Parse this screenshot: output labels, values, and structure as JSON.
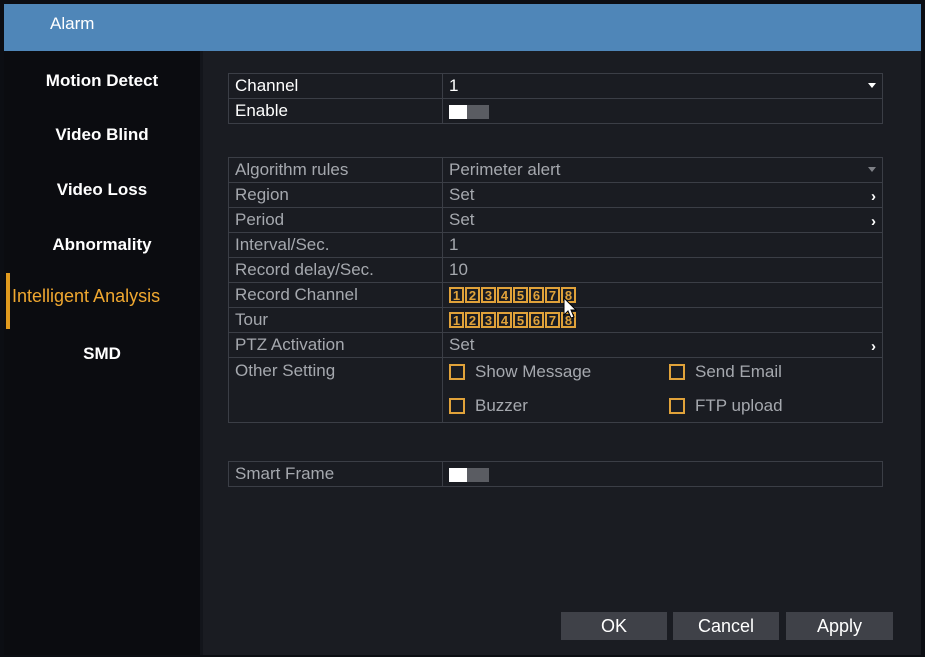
{
  "window": {
    "title": "Alarm"
  },
  "sidebar": {
    "items": [
      {
        "label": "Motion Detect"
      },
      {
        "label": "Video Blind"
      },
      {
        "label": "Video Loss"
      },
      {
        "label": "Abnormality"
      },
      {
        "label": "Intelligent Analysis",
        "active": true
      },
      {
        "label": "SMD"
      }
    ]
  },
  "channel": {
    "label": "Channel",
    "value": "1"
  },
  "enable": {
    "label": "Enable",
    "state": "off"
  },
  "rules": {
    "algorithm": {
      "label": "Algorithm rules",
      "value": "Perimeter alert"
    },
    "region": {
      "label": "Region",
      "value": "Set"
    },
    "period": {
      "label": "Period",
      "value": "Set"
    },
    "interval": {
      "label": "Interval/Sec.",
      "value": "1"
    },
    "record_delay": {
      "label": "Record delay/Sec.",
      "value": "10"
    },
    "record_channel": {
      "label": "Record Channel",
      "channels": [
        "1",
        "2",
        "3",
        "4",
        "5",
        "6",
        "7",
        "8"
      ]
    },
    "tour": {
      "label": "Tour",
      "channels": [
        "1",
        "2",
        "3",
        "4",
        "5",
        "6",
        "7",
        "8"
      ]
    },
    "ptz": {
      "label": "PTZ Activation",
      "value": "Set"
    },
    "other": {
      "label": "Other Setting",
      "options": [
        "Show Message",
        "Send Email",
        "Buzzer",
        "FTP upload"
      ]
    }
  },
  "smart_frame": {
    "label": "Smart Frame",
    "state": "off"
  },
  "buttons": {
    "ok": "OK",
    "cancel": "Cancel",
    "apply": "Apply"
  },
  "colors": {
    "titlebar": "#4f86b8",
    "accent": "#e0a23a",
    "panel": "#1a1c22"
  }
}
